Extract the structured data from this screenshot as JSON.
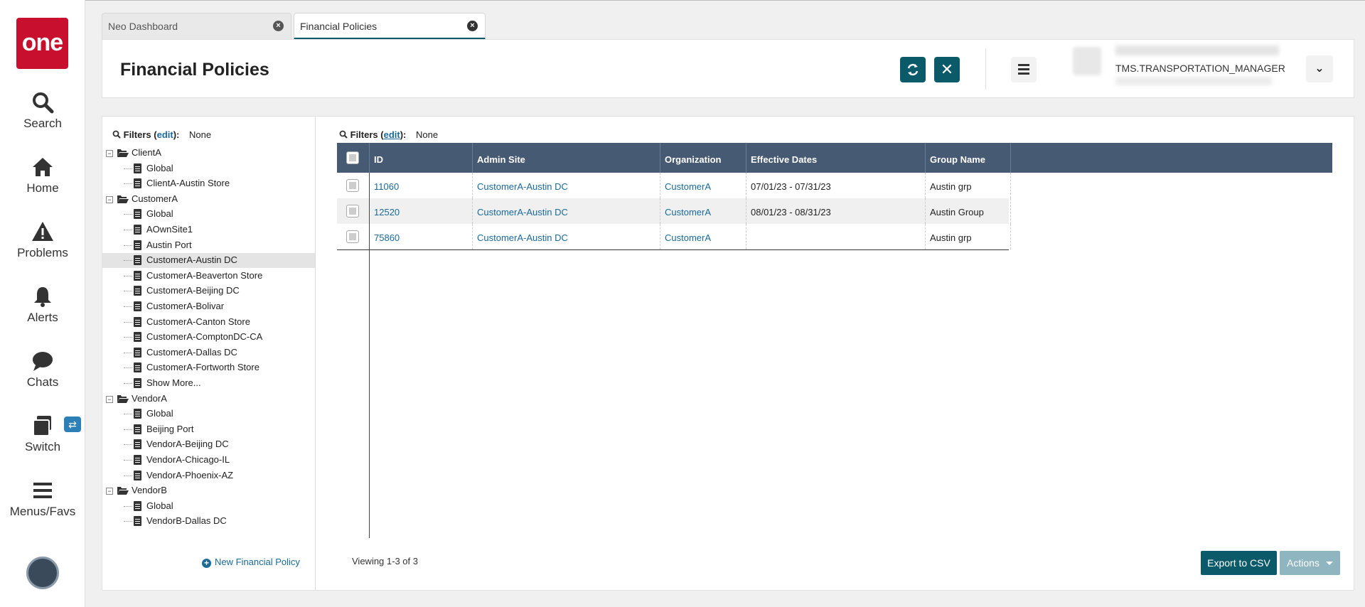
{
  "nav": {
    "logo": "one",
    "items": [
      {
        "label": "Search",
        "icon": "search-icon"
      },
      {
        "label": "Home",
        "icon": "home-icon"
      },
      {
        "label": "Problems",
        "icon": "warning-icon"
      },
      {
        "label": "Alerts",
        "icon": "bell-icon"
      },
      {
        "label": "Chats",
        "icon": "chat-icon"
      },
      {
        "label": "Switch",
        "icon": "switch-icon"
      },
      {
        "label": "Menus/Favs",
        "icon": "hamburger-icon"
      }
    ]
  },
  "tabs": [
    {
      "label": "Neo Dashboard",
      "active": false
    },
    {
      "label": "Financial Policies",
      "active": true
    }
  ],
  "header": {
    "title": "Financial Policies",
    "user_name": "TMS.TRANSPORTATION_MANAGER"
  },
  "tree": {
    "filters_label": "Filters",
    "filters_edit": "edit",
    "filters_value": "None",
    "nodes": [
      {
        "label": "ClientA",
        "type": "folder"
      },
      {
        "label": "Global",
        "type": "doc"
      },
      {
        "label": "ClientA-Austin Store",
        "type": "doc"
      },
      {
        "label": "CustomerA",
        "type": "folder"
      },
      {
        "label": "Global",
        "type": "doc"
      },
      {
        "label": "AOwnSite1",
        "type": "doc"
      },
      {
        "label": "Austin Port",
        "type": "doc"
      },
      {
        "label": "CustomerA-Austin DC",
        "type": "doc",
        "selected": true
      },
      {
        "label": "CustomerA-Beaverton Store",
        "type": "doc"
      },
      {
        "label": "CustomerA-Beijing DC",
        "type": "doc"
      },
      {
        "label": "CustomerA-Bolivar",
        "type": "doc"
      },
      {
        "label": "CustomerA-Canton Store",
        "type": "doc"
      },
      {
        "label": "CustomerA-ComptonDC-CA",
        "type": "doc"
      },
      {
        "label": "CustomerA-Dallas DC",
        "type": "doc"
      },
      {
        "label": "CustomerA-Fortworth Store",
        "type": "doc"
      },
      {
        "label": "Show More...",
        "type": "doc"
      },
      {
        "label": "VendorA",
        "type": "folder"
      },
      {
        "label": "Global",
        "type": "doc"
      },
      {
        "label": "Beijing Port",
        "type": "doc"
      },
      {
        "label": "VendorA-Beijing DC",
        "type": "doc"
      },
      {
        "label": "VendorA-Chicago-IL",
        "type": "doc"
      },
      {
        "label": "VendorA-Phoenix-AZ",
        "type": "doc"
      },
      {
        "label": "VendorB",
        "type": "folder"
      },
      {
        "label": "Global",
        "type": "doc"
      },
      {
        "label": "VendorB-Dallas DC",
        "type": "doc"
      }
    ],
    "new_policy": "New Financial Policy"
  },
  "grid": {
    "filters_label": "Filters",
    "filters_edit": "edit",
    "filters_value": "None",
    "columns": [
      "ID",
      "Admin Site",
      "Organization",
      "Effective Dates",
      "Group Name"
    ],
    "rows": [
      {
        "id": "11060",
        "admin_site": "CustomerA-Austin DC",
        "organization": "CustomerA",
        "effective_dates": "07/01/23 - 07/31/23",
        "group_name": "Austin grp"
      },
      {
        "id": "12520",
        "admin_site": "CustomerA-Austin DC",
        "organization": "CustomerA",
        "effective_dates": "08/01/23 - 08/31/23",
        "group_name": "Austin Group"
      },
      {
        "id": "75860",
        "admin_site": "CustomerA-Austin DC",
        "organization": "CustomerA",
        "effective_dates": "",
        "group_name": "Austin grp"
      }
    ],
    "viewing": "Viewing 1-3 of 3",
    "export_label": "Export to CSV",
    "actions_label": "Actions"
  },
  "colors": {
    "brand": "#c8102e",
    "primary": "#0b5a6a",
    "grid_header": "#465a73",
    "link": "#1a6a9a"
  }
}
